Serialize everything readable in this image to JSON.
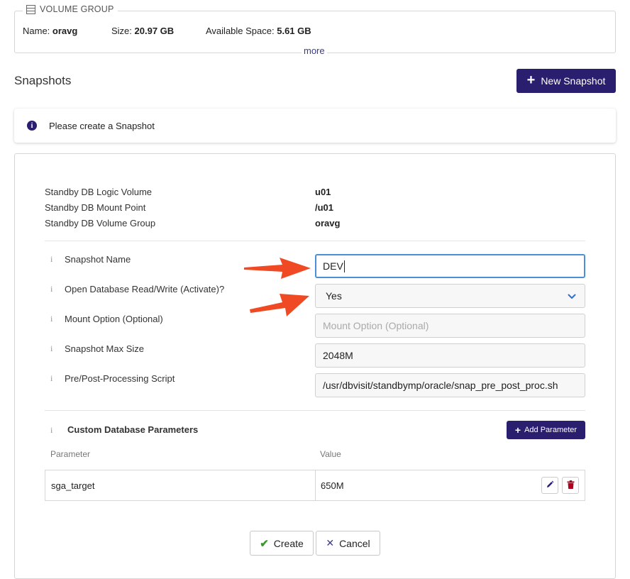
{
  "volume_group": {
    "legend": "VOLUME GROUP",
    "name_label": "Name:",
    "name_value": "oravg",
    "size_label": "Size:",
    "size_value": "20.97 GB",
    "avail_label": "Available Space:",
    "avail_value": "5.61 GB",
    "more_link": "more"
  },
  "snapshots": {
    "title": "Snapshots",
    "new_button": "New Snapshot",
    "info_message": "Please create a Snapshot"
  },
  "standby": [
    {
      "label": "Standby DB Logic Volume",
      "value": "u01"
    },
    {
      "label": "Standby DB Mount Point",
      "value": "/u01"
    },
    {
      "label": "Standby DB Volume Group",
      "value": "oravg"
    }
  ],
  "form": {
    "info_glyph": "i",
    "snapshot_name": {
      "label": "Snapshot Name",
      "value": "DEV"
    },
    "open_db": {
      "label": "Open Database Read/Write (Activate)?",
      "value": "Yes"
    },
    "mount_option": {
      "label": "Mount Option (Optional)",
      "value": "",
      "placeholder": "Mount Option (Optional)"
    },
    "max_size": {
      "label": "Snapshot Max Size",
      "value": "2048M"
    },
    "script": {
      "label": "Pre/Post-Processing Script",
      "value": "/usr/dbvisit/standbymp/oracle/snap_pre_post_proc.sh"
    }
  },
  "custom_params": {
    "title": "Custom Database Parameters",
    "add_button": "Add Parameter",
    "col_parameter": "Parameter",
    "col_value": "Value",
    "rows": [
      {
        "parameter": "sga_target",
        "value": "650M"
      }
    ]
  },
  "actions": {
    "create": "Create",
    "cancel": "Cancel"
  },
  "colors": {
    "primary": "#2a1e6e",
    "annotation_arrow": "#f04a24",
    "focus_border": "#4a90d9",
    "create_check": "#3a9b2c",
    "delete_icon": "#b0001e"
  },
  "icons": [
    "database-stack-icon",
    "plus-icon",
    "info-circle-icon",
    "chevron-down-icon",
    "pencil-icon",
    "trash-icon",
    "check-icon",
    "close-icon"
  ]
}
